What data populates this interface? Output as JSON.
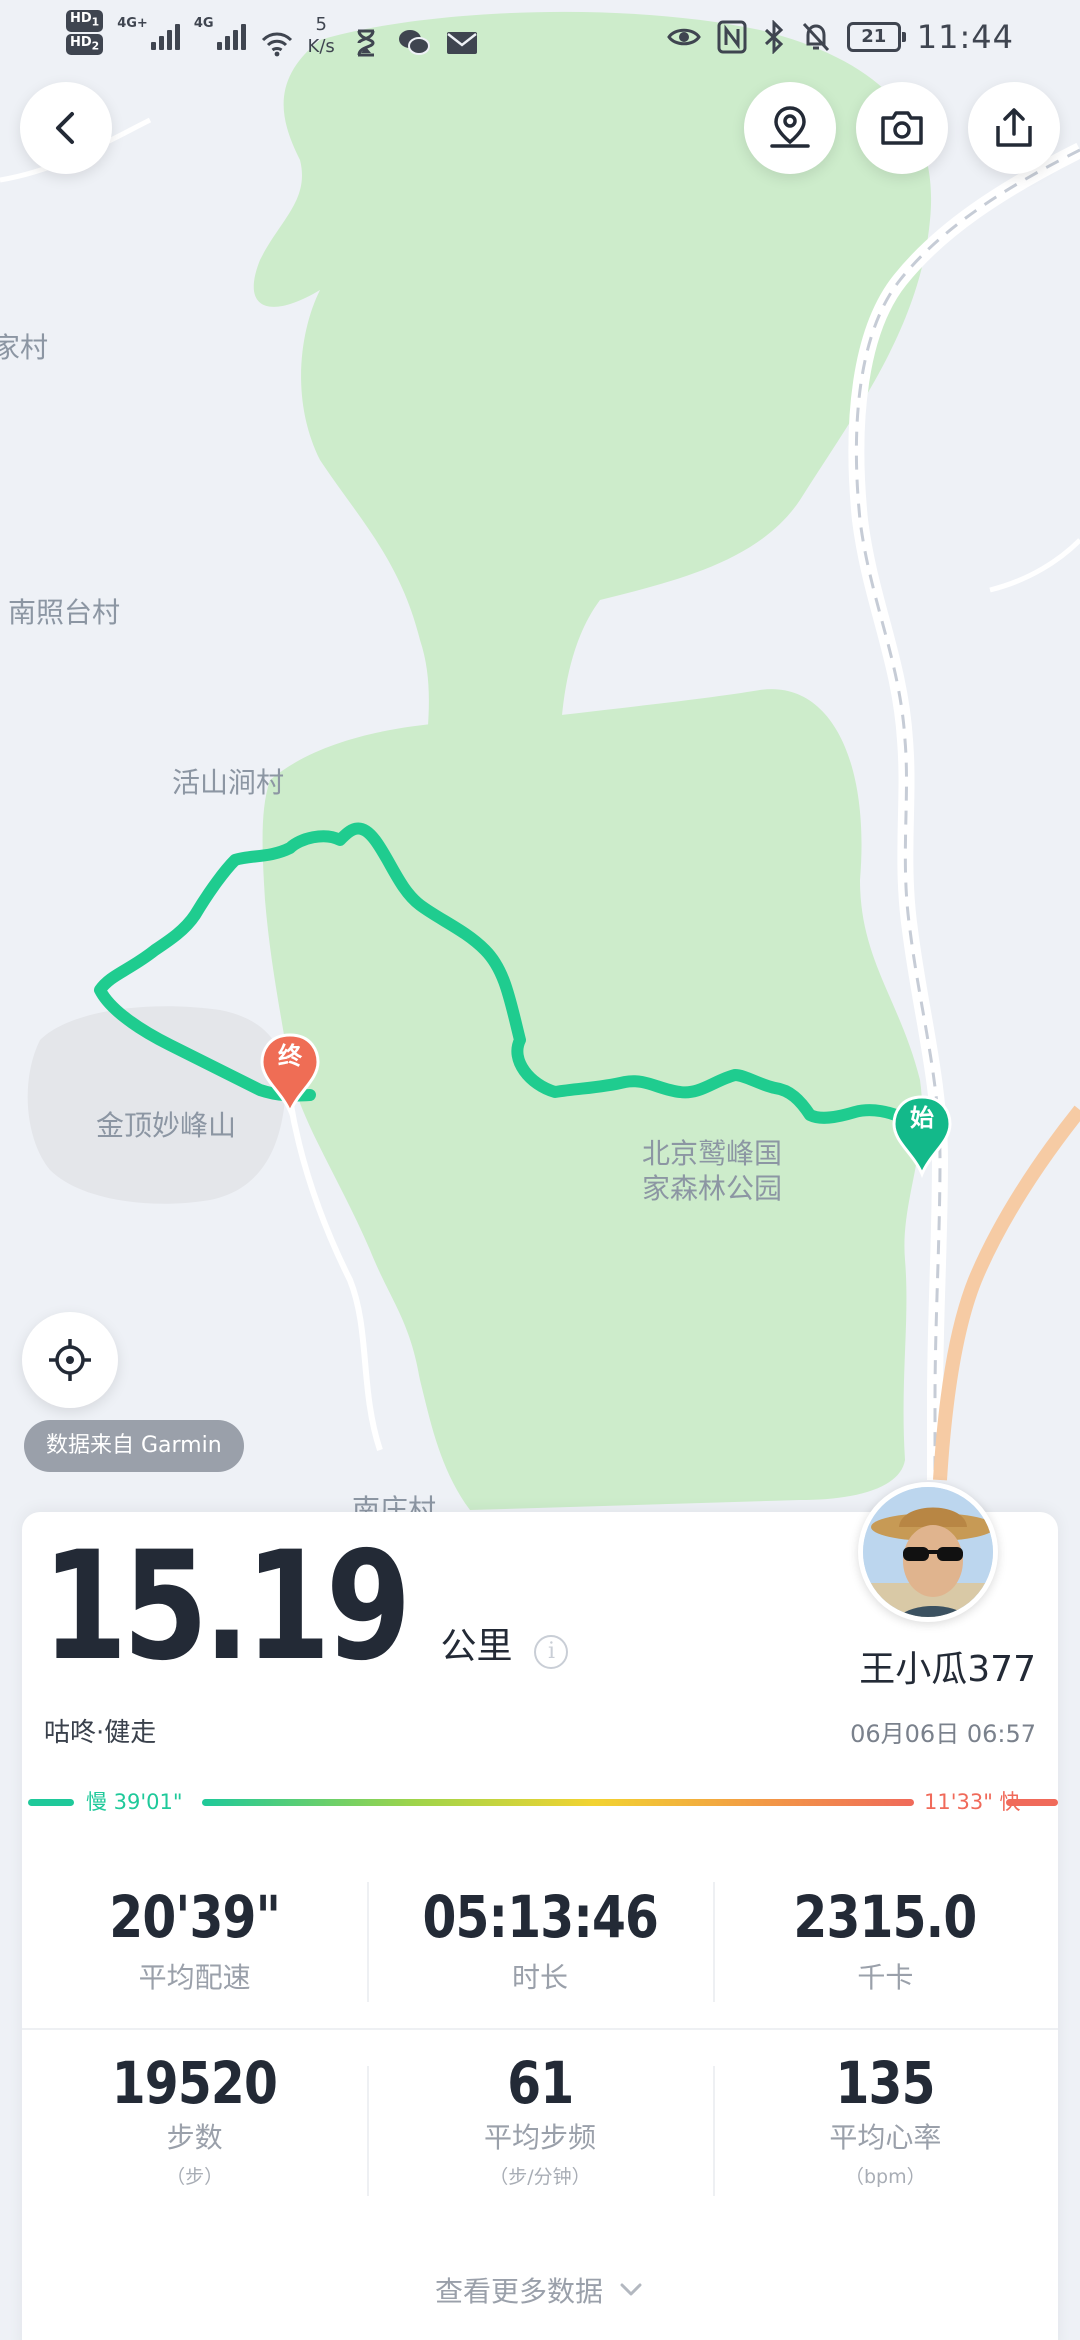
{
  "status_bar": {
    "hd1": "HD",
    "hd1_sub": "1",
    "hd2": "HD",
    "hd2_sub": "2",
    "net1": "4G+",
    "net2": "4G",
    "speed_value": "5",
    "speed_unit": "K/s",
    "battery": "21",
    "time": "11:44"
  },
  "map": {
    "labels": {
      "village_edge": "家村",
      "nanzhaotai": "南照台村",
      "huoshanjian": "活山涧村",
      "jinding": "金顶妙峰山",
      "park_line1": "北京鹫峰国",
      "park_line2": "家森林公园",
      "nanzhuang": "南庄村"
    },
    "end_marker": "终",
    "start_marker": "始",
    "route_color": "#1fcc8f",
    "forest_color": "#cdeccb",
    "end_color": "#ef6d55",
    "start_color": "#13b98a"
  },
  "data_source": "数据来自 Garmin",
  "summary": {
    "distance": "15.19",
    "distance_unit": "公里",
    "info_icon": "i",
    "activity": "咕咚·健走",
    "username": "王小瓜377",
    "datetime": "06月06日 06:57"
  },
  "pace_legend": {
    "slow": "慢 39'01\"",
    "fast": "11'33\" 快",
    "slow_color": "#1fc99a",
    "fast_color": "#f06a5a"
  },
  "stats": {
    "row1": [
      {
        "value": "20'39\"",
        "label": "平均配速"
      },
      {
        "value": "05:13:46",
        "label": "时长"
      },
      {
        "value": "2315.0",
        "label": "千卡"
      }
    ],
    "row2": [
      {
        "value": "19520",
        "label": "步数",
        "unit": "（步）"
      },
      {
        "value": "61",
        "label": "平均步频",
        "unit": "（步/分钟）"
      },
      {
        "value": "135",
        "label": "平均心率",
        "unit": "（bpm）"
      }
    ]
  },
  "more_label": "查看更多数据"
}
